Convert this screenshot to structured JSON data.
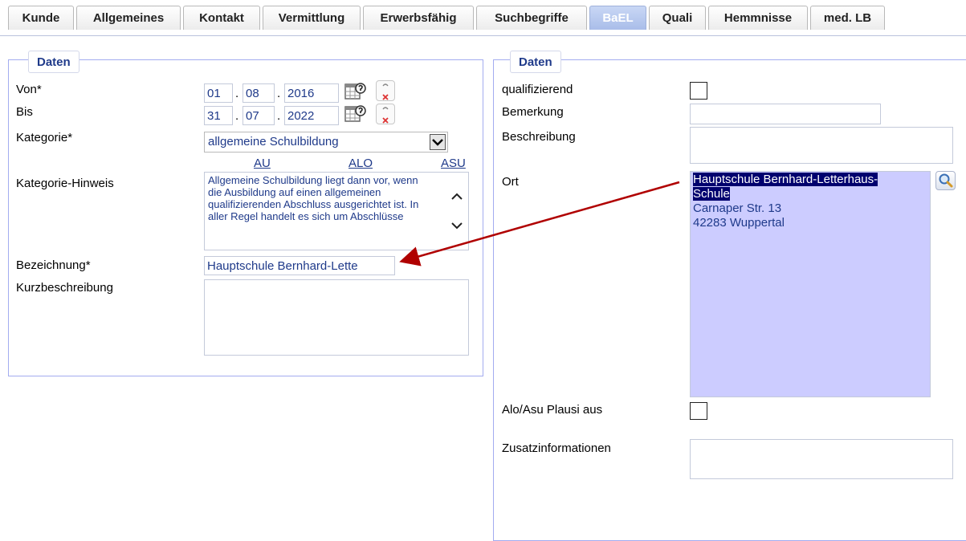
{
  "tabs": [
    {
      "label": "Kunde"
    },
    {
      "label": "Allgemeines"
    },
    {
      "label": "Kontakt"
    },
    {
      "label": "Vermittlung"
    },
    {
      "label": "Erwerbsfähig"
    },
    {
      "label": "Suchbegriffe"
    },
    {
      "label": "BaEL"
    },
    {
      "label": "Quali"
    },
    {
      "label": "Hemmnisse"
    },
    {
      "label": "med. LB"
    }
  ],
  "active_tab": "BaEL",
  "left": {
    "legend": "Daten",
    "von": {
      "label": "Von*",
      "day": "01",
      "month": "08",
      "year": "2016"
    },
    "bis": {
      "label": "Bis",
      "day": "31",
      "month": "07",
      "year": "2022"
    },
    "kategorie": {
      "label": "Kategorie*",
      "value": "allgemeine Schulbildung"
    },
    "links": {
      "au": "AU",
      "alo": "ALO",
      "asu": "ASU"
    },
    "hinweis": {
      "label": "Kategorie-Hinweis",
      "text": "Allgemeine Schulbildung liegt dann vor, wenn die Ausbildung auf einen allgemeinen qualifizierenden Abschluss ausgerichtet ist. In aller Regel handelt es sich um Abschlüsse"
    },
    "bezeichnung": {
      "label": "Bezeichnung*",
      "value": "Hauptschule Bernhard-Lette"
    },
    "kurzbeschreibung": {
      "label": "Kurzbeschreibung",
      "value": ""
    }
  },
  "right": {
    "legend": "Daten",
    "qualifizierend": {
      "label": "qualifizierend",
      "checked": false
    },
    "bemerkung": {
      "label": "Bemerkung",
      "value": ""
    },
    "beschreibung": {
      "label": "Beschreibung",
      "value": ""
    },
    "ort": {
      "label": "Ort",
      "line1": "Hauptschule Bernhard-Letterhaus-",
      "line2": "Schule",
      "line3": "Carnaper Str.  13",
      "line4": "42283  Wuppertal"
    },
    "plausi": {
      "label": "Alo/Asu Plausi aus",
      "checked": false
    },
    "zusatz": {
      "label": "Zusatzinformationen",
      "value": ""
    }
  },
  "colors": {
    "accent": "#1f3a8a",
    "panel_border": "#a3acf0",
    "ort_background": "#ccccff",
    "selection": "#00006e",
    "annotation_arrow": "#b00000"
  }
}
